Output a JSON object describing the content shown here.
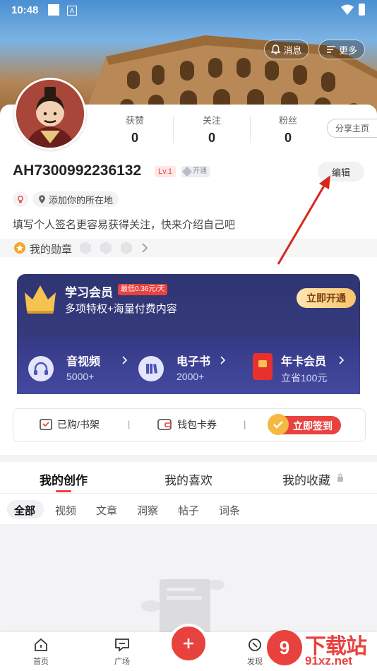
{
  "status": {
    "time": "10:48"
  },
  "top_actions": {
    "messages": "消息",
    "more": "更多"
  },
  "profile": {
    "username": "AH7300992236132",
    "level": "Lv.1",
    "vip_badge": "开通",
    "location": "添加你的所在地",
    "bio": "填写个人签名更容易获得关注，快来介绍自己吧",
    "medals_label": "我的勋章",
    "share_label": "分享主页",
    "edit_label": "编辑"
  },
  "stats": [
    {
      "label": "获赞",
      "value": "0"
    },
    {
      "label": "关注",
      "value": "0"
    },
    {
      "label": "粉丝",
      "value": "0"
    }
  ],
  "vip": {
    "title": "学习会员",
    "price_tag": "最低0.36元/天",
    "desc": "多项特权+海量付费内容",
    "cta": "立即开通",
    "features": [
      {
        "title": "音视频",
        "sub": "5000+"
      },
      {
        "title": "电子书",
        "sub": "2000+"
      },
      {
        "title": "年卡会员",
        "sub": "立省100元"
      }
    ]
  },
  "quick": {
    "purchased": "已购/书架",
    "wallet": "钱包卡券",
    "checkin": "立即签到"
  },
  "tabs": [
    "我的创作",
    "我的喜欢",
    "我的收藏"
  ],
  "subtabs": [
    "全部",
    "视频",
    "文章",
    "洞察",
    "帖子",
    "词条"
  ],
  "nav": {
    "home": "首页",
    "square": "广场",
    "discover": "发现"
  },
  "watermark": "下载站 91xz.net",
  "colors": {
    "accent": "#e8423f",
    "vip_bg": "#2f3572",
    "gold": "#f5b942"
  }
}
